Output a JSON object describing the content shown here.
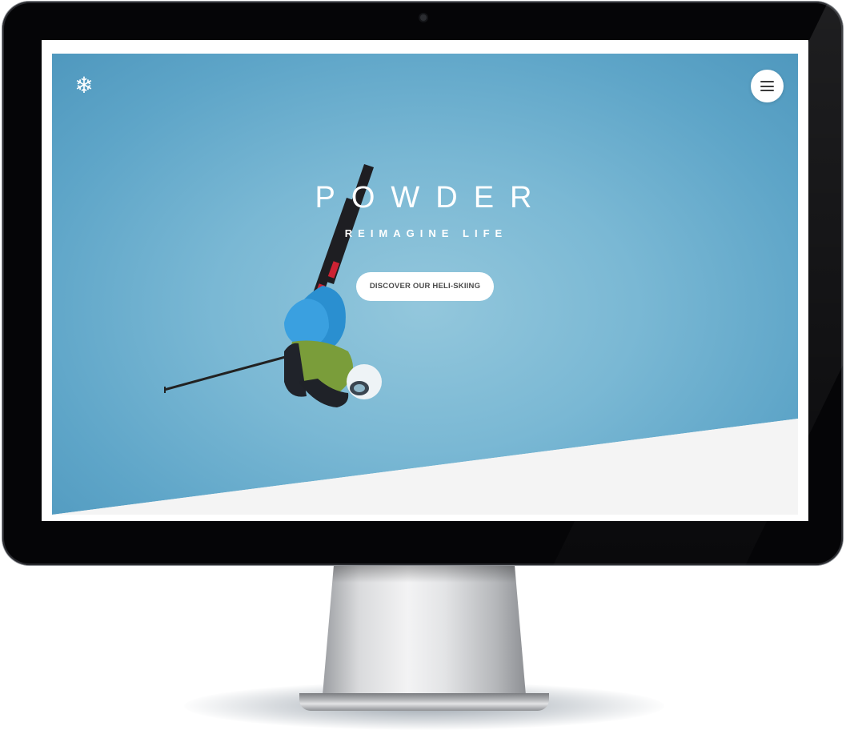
{
  "site": {
    "logo_icon": "snowflake-icon",
    "menu_icon": "hamburger-menu-icon"
  },
  "hero": {
    "title": "POWDER",
    "subtitle": "REIMAGINE LIFE",
    "cta_label": "DISCOVER OUR HELI-SKIING"
  },
  "colors": {
    "sky": "#7ab8d4",
    "sky_dark": "#4f98be",
    "bottom_section": "#f4f4f4",
    "text_on_hero": "#ffffff",
    "button_bg": "#ffffff",
    "button_text": "#4b4b4b"
  }
}
